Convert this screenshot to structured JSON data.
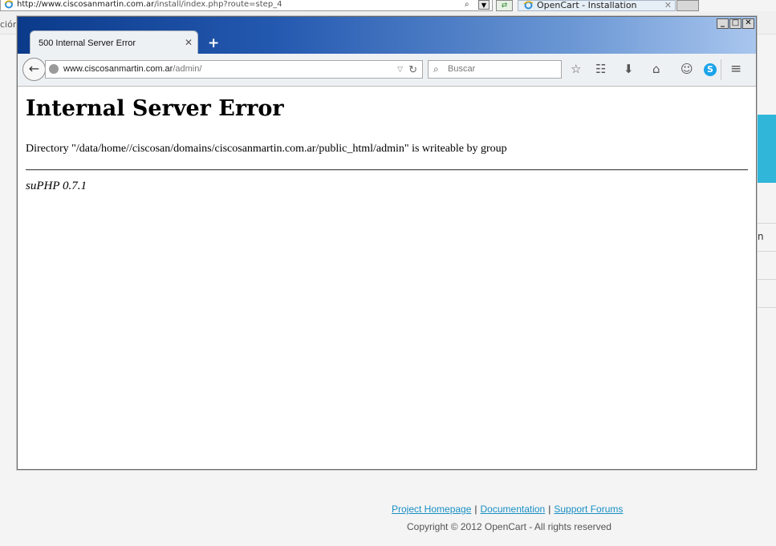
{
  "ie_window": {
    "address": {
      "host": "http://www.ciscosanmartin.com.ar",
      "path": "/install/index.php?route=step_4"
    },
    "tab": {
      "title": "OpenCart - Installation"
    },
    "left_fragment": "ción",
    "right_fragment": "n"
  },
  "firefox": {
    "tab": {
      "title": "500 Internal Server Error"
    },
    "url": {
      "host": "www.ciscosanmartin.com.ar",
      "path": "/admin/"
    },
    "search": {
      "placeholder": "Buscar"
    }
  },
  "error_page": {
    "title": "Internal Server Error",
    "message": "Directory \"/data/home//ciscosan/domains/ciscosanmartin.com.ar/public_html/admin\" is writeable by group",
    "signature": "suPHP 0.7.1"
  },
  "footer": {
    "links": [
      "Project Homepage",
      "Documentation",
      "Support Forums"
    ],
    "separator": "|",
    "copyright": "Copyright © 2012 OpenCart - All rights reserved"
  },
  "colors": {
    "link": "#1a8fc4",
    "accent_strip": "#30b6d9",
    "title_bar": "#2459b0"
  }
}
